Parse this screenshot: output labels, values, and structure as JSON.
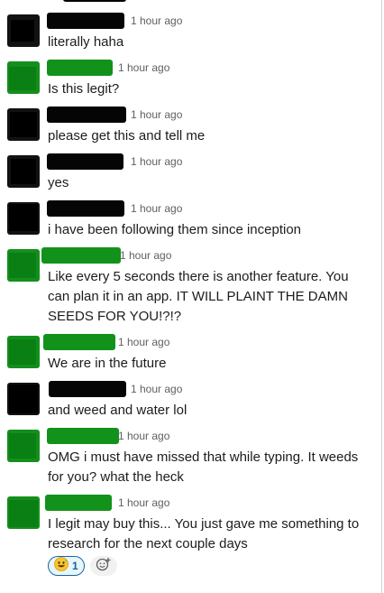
{
  "messages": [
    {
      "time": "1 hour ago",
      "text": "literally haha"
    },
    {
      "time": "1 hour ago",
      "text": "Is this legit?"
    },
    {
      "time": "1 hour ago",
      "text": "please get this and tell me"
    },
    {
      "time": "1 hour ago",
      "text": "yes"
    },
    {
      "time": "1 hour ago",
      "text": "i have been following them since inception"
    },
    {
      "time": "1 hour ago",
      "text": "Like every 5 seconds there is another feature. You can plan it in an app. IT WILL PLAINT THE DAMN SEEDS FOR YOU!?!?"
    },
    {
      "time": "1 hour ago",
      "text": "We are in the future"
    },
    {
      "time": "1 hour ago",
      "text": "and weed and water lol"
    },
    {
      "time": "1 hour ago",
      "text": "OMG i must have missed that while typing. It weeds for you? what the heck"
    },
    {
      "time": "1 hour ago",
      "text": "I legit may buy this... You just gave me something to research for the next couple days"
    }
  ],
  "reaction": {
    "emoji": "grinning-sweat-emoji",
    "count": "1"
  },
  "colors": {
    "link_blue": "#1264a3",
    "redact_green": "#13921b",
    "redact_black": "#050505"
  }
}
